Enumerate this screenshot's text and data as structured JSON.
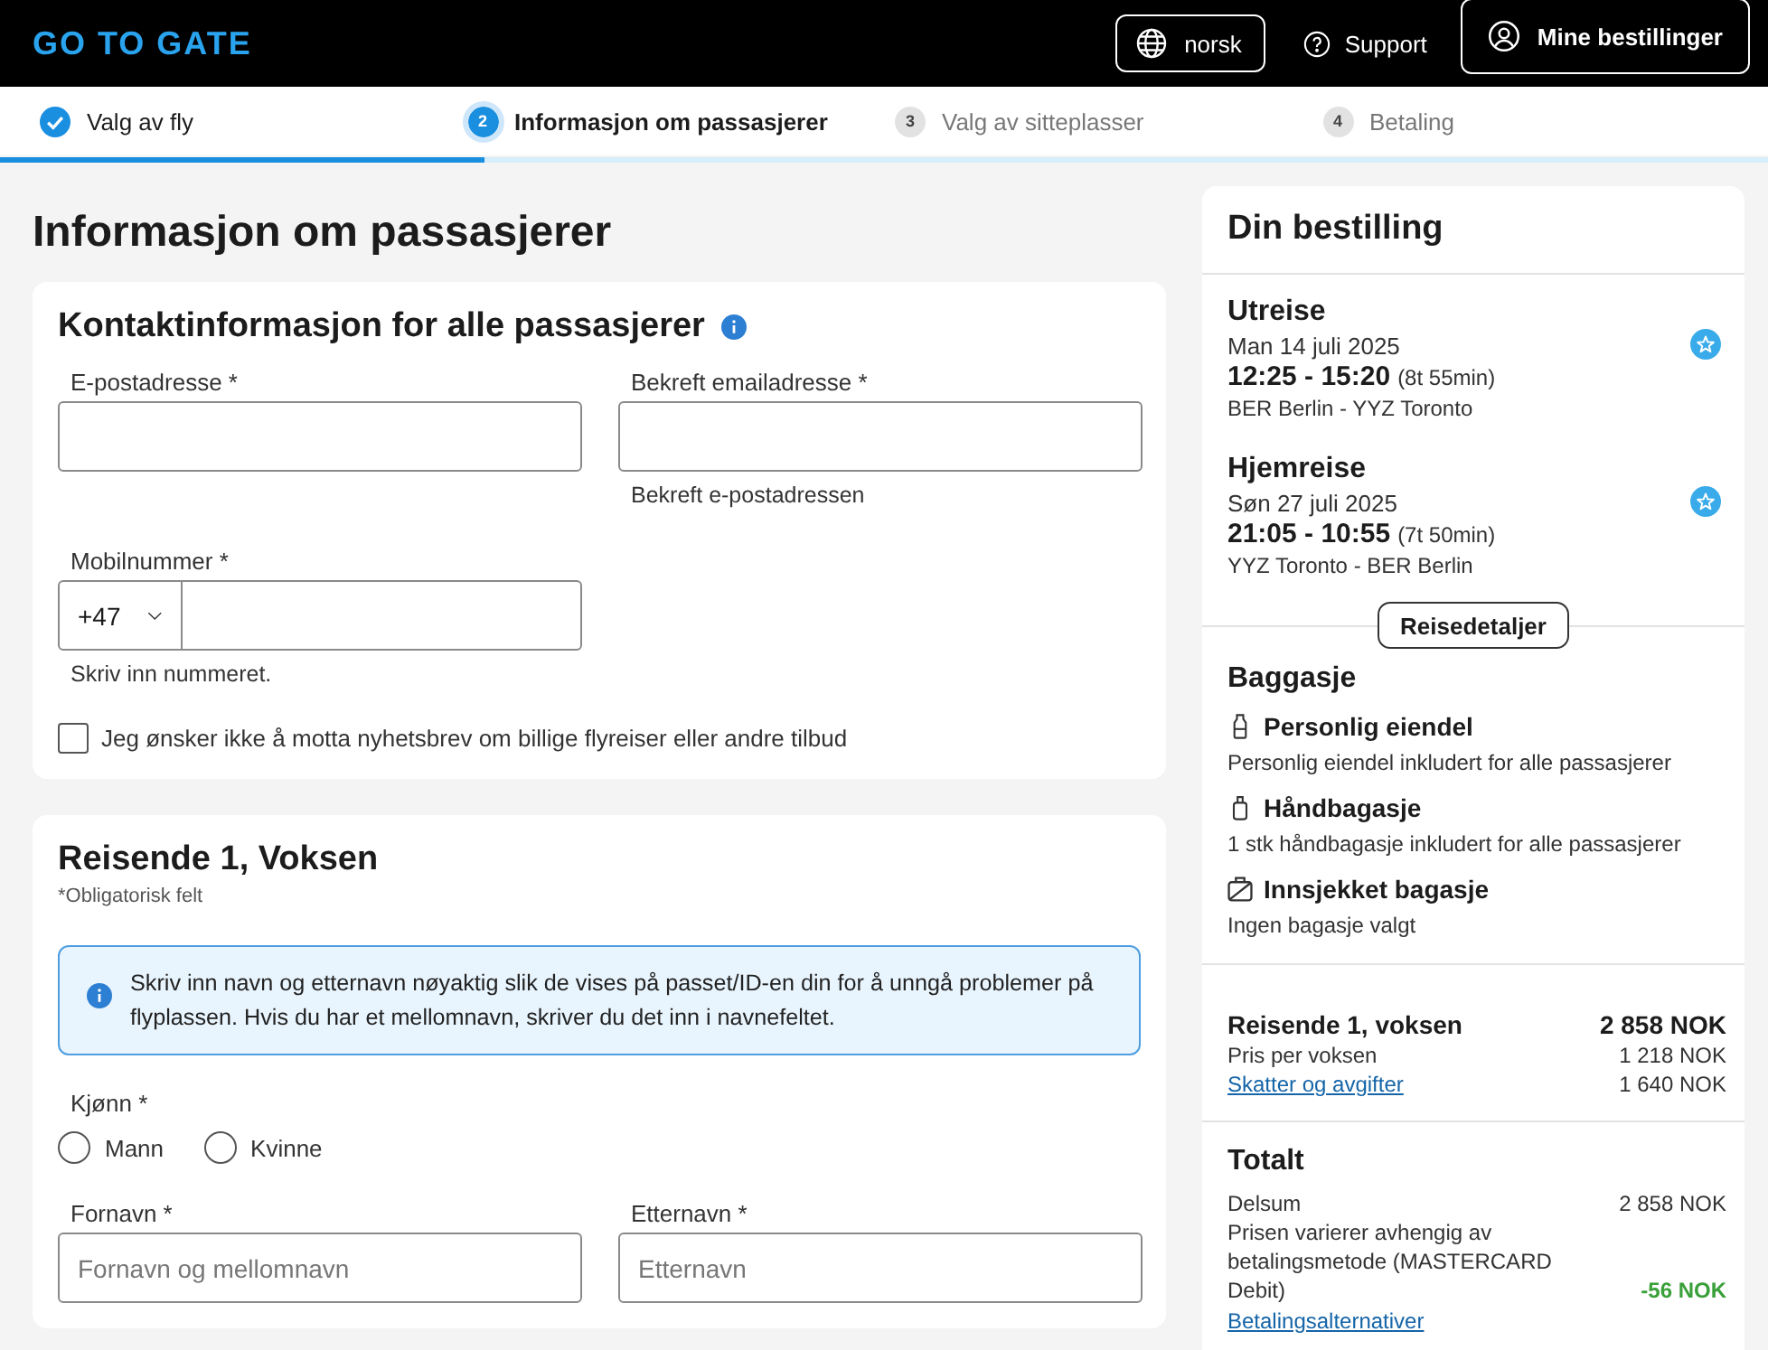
{
  "header": {
    "logo": "GO TO GATE",
    "language": "norsk",
    "support": "Support",
    "bookings": "Mine bestillinger"
  },
  "steps": [
    {
      "label": "Valg av fly",
      "completed": true,
      "selected": false
    },
    {
      "number": "2",
      "label": "Informasjon om passasjerer",
      "completed": false,
      "selected": true
    },
    {
      "number": "3",
      "label": "Valg av sitteplasser",
      "completed": false,
      "selected": false
    },
    {
      "number": "4",
      "label": "Betaling",
      "completed": false,
      "selected": false
    }
  ],
  "progress": {
    "level": 0.274
  },
  "page_title": "Informasjon om passasjerer",
  "contact": {
    "title": "Kontaktinformasjon for alle passasjerer",
    "email_label": "E-postadresse *",
    "confirm_label": "Bekreft emailadresse *",
    "confirm_hint": "Bekreft e-postadressen",
    "phone_label": "Mobilnummer *",
    "country_code": "+47",
    "phone_hint": "Skriv inn nummeret.",
    "newsletter_opt_out": {
      "label": "Jeg ønsker ikke å motta nyhetsbrev om billige flyreiser eller andre tilbud",
      "checked": false
    }
  },
  "traveler": {
    "title": "Reisende 1, Voksen",
    "note": "*Obligatorisk felt",
    "notice": "Skriv inn navn og etternavn nøyaktig slik de vises på passet/ID-en din for å unngå problemer på flyplassen. Hvis du har et mellomnavn, skriver du det inn i navnefeltet.",
    "gender": {
      "label": "Kjønn *",
      "options": [
        {
          "label": "Mann",
          "selected": false
        },
        {
          "label": "Kvinne",
          "selected": false
        }
      ]
    },
    "first_name": {
      "label": "Fornavn *",
      "placeholder": "Fornavn og mellomnavn"
    },
    "last_name": {
      "label": "Etternavn *",
      "placeholder": "Etternavn"
    }
  },
  "summary": {
    "title": "Din bestilling",
    "flights": [
      {
        "heading": "Utreise",
        "date": "Man 14 juli 2025",
        "times": "12:25 - 15:20",
        "duration": "(8t 55min)",
        "route": "BER Berlin - YYZ Toronto"
      },
      {
        "heading": "Hjemreise",
        "date": "Søn 27 juli 2025",
        "times": "21:05 - 10:55",
        "duration": "(7t 50min)",
        "route": "YYZ Toronto - BER Berlin"
      }
    ],
    "details_button": "Reisedetaljer",
    "baggage": {
      "title": "Baggasje",
      "items": [
        {
          "kind": "personal",
          "name": "Personlig eiendel",
          "description": "Personlig eiendel inkludert for alle passasjerer"
        },
        {
          "kind": "cabin",
          "name": "Håndbagasje",
          "description": "1 stk håndbagasje inkludert for alle passasjerer"
        },
        {
          "kind": "checked",
          "name": "Innsjekket bagasje",
          "description": "Ingen bagasje valgt"
        }
      ]
    },
    "passenger_price": {
      "title": "Reisende 1, voksen",
      "total": "2 858 NOK",
      "lines": [
        {
          "kind": "text",
          "label": "Pris per voksen",
          "amount": "1 218 NOK"
        },
        {
          "kind": "link",
          "label": "Skatter og avgifter",
          "amount": "1 640 NOK"
        }
      ]
    },
    "totals": {
      "title": "Totalt",
      "lines": [
        {
          "kind": "amount",
          "label": "Delsum",
          "amount": "2 858 NOK"
        },
        {
          "kind": "discount",
          "label": "Prisen varierer avhengig av betalingsmetode (MASTERCARD Debit)",
          "amount": "-56 NOK"
        }
      ],
      "link": "Betalingsalternativer"
    }
  }
}
